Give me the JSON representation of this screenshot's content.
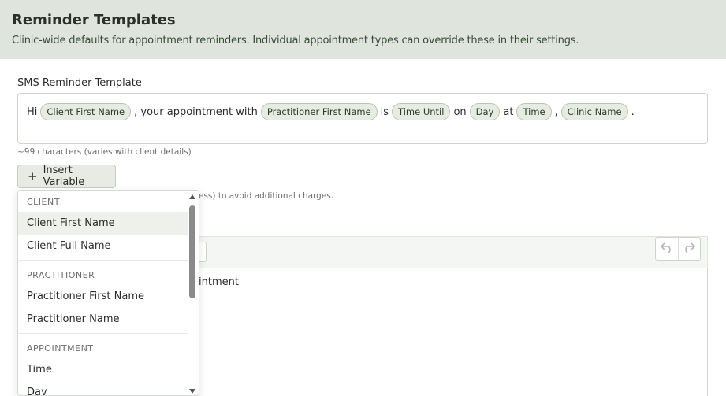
{
  "header": {
    "title": "Reminder Templates",
    "subtitle": "Clinic-wide defaults for appointment reminders. Individual appointment types can override these in their settings."
  },
  "sms": {
    "label": "SMS Reminder Template",
    "segments": {
      "t1": "Hi",
      "c1": "Client First Name",
      "t2": ", your appointment with",
      "c2": "Practitioner First Name",
      "t3": "is",
      "c3": "Time Until",
      "t4": "on",
      "c4": "Day",
      "t5": "at",
      "c5": "Time",
      "t6": ",",
      "c6": "Clinic Name",
      "t7": "."
    },
    "char_count": "~99 characters (varies with client details)",
    "insert_button": "Insert Variable",
    "partial_note": "ess) to avoid additional charges."
  },
  "email": {
    "partial_body": "intment"
  },
  "variable_menu": {
    "groups": [
      {
        "label": "CLIENT",
        "items": [
          "Client First Name",
          "Client Full Name"
        ]
      },
      {
        "label": "PRACTITIONER",
        "items": [
          "Practitioner First Name",
          "Practitioner Name"
        ]
      },
      {
        "label": "APPOINTMENT",
        "items": [
          "Time",
          "Day"
        ]
      }
    ],
    "highlighted": "Client First Name"
  },
  "icons": {
    "insert": "plus-icon",
    "undo": "undo-icon",
    "redo": "redo-icon",
    "scroll_up": "scroll-up-arrow",
    "scroll_down": "scroll-down-arrow"
  },
  "colors": {
    "header_bg": "#dfe5dc",
    "chip_bg": "#e6ece2",
    "chip_border": "#b8c6b0",
    "button_bg": "#e7ebe4"
  }
}
